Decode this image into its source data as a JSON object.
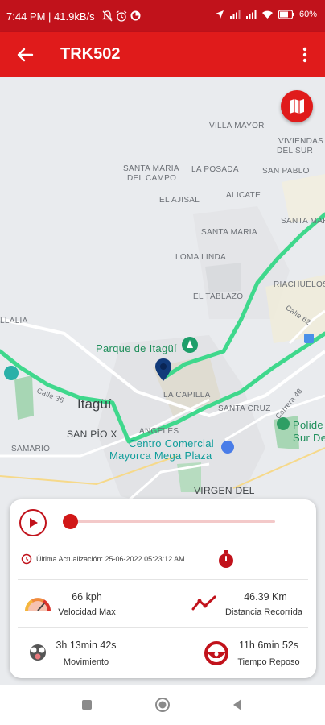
{
  "status_bar": {
    "left_text": "7:44 PM | 41.9kB/s",
    "battery": "60",
    "icons": [
      "mute-bell-icon",
      "alarm-icon",
      "app-notification-icon",
      "location-arrow-icon",
      "signal-icon",
      "signal-icon",
      "wifi-icon",
      "battery-icon"
    ]
  },
  "app_bar": {
    "title": "TRK502",
    "back_icon": "arrow-left-icon",
    "menu_icon": "more-vertical-icon"
  },
  "map": {
    "labels": {
      "villa_mayor": "VILLA MAYOR",
      "viviendas_1": "VIVIENDAS",
      "viviendas_2": "DEL SUR",
      "santa_maria_campo_1": "SANTA MARIA",
      "santa_maria_campo_2": "DEL CAMPO",
      "la_posada": "LA POSADA",
      "san_pablo": "SAN PABLO",
      "el_ajisal": "EL AJISAL",
      "alicate": "ALICATE",
      "santa_maria_right": "SANTA MARIA",
      "santa_maria_center": "SANTA MARIA",
      "loma_linda": "LOMA LINDA",
      "riachuelos": "RIACHUELOS",
      "el_tablazo": "EL TABLAZO",
      "calle_62": "Calle 62",
      "llalia": "LLALIA",
      "parque_itagui": "Parque de Itagüí",
      "la_capilla": "LA CAPILLA",
      "calle_36": "Calle 36",
      "itagui": "Itagüí",
      "santa_cruz": "SANTA CRUZ",
      "carrera_48": "Carrera 48",
      "polide_1": "Polide",
      "polide_2": "Sur De",
      "angeles": "ANGELES",
      "san_pio": "SAN PÍO X",
      "centro_comercial_1": "Centro Comercial",
      "centro_comercial_2": "Mayorca Mega Plaza",
      "samario": "SAMARIO",
      "virgen_del": "VIRGEN DEL"
    },
    "route_color": "#3fd88c",
    "marker_color": "#123a7a",
    "map_type_button_icon": "map-icon"
  },
  "panel": {
    "play_icon": "play-icon",
    "slider_progress": 0.0,
    "update_label": "Última Actualización: 25-06-2022 05:23:12 AM",
    "timer_icon": "stopwatch-icon",
    "stats": {
      "max_speed": {
        "value": "66 kph",
        "label": "Velocidad Max",
        "icon": "speedometer-icon"
      },
      "distance": {
        "value": "46.39 Km",
        "label": "Distancia Recorrida",
        "icon": "trend-line-icon"
      },
      "movement": {
        "value": "3h 13min 42s",
        "label": "Movimiento",
        "icon": "engine-icon"
      },
      "rest": {
        "value": "11h 6min 52s",
        "label": "Tiempo Reposo",
        "icon": "steering-wheel-icon"
      }
    }
  },
  "nav_bar": {
    "buttons": [
      "recents-square-icon",
      "home-circle-icon",
      "back-triangle-icon"
    ]
  },
  "colors": {
    "primary": "#e01b1b",
    "status_bar": "#c1121b",
    "accent_dark": "#c1121b"
  }
}
